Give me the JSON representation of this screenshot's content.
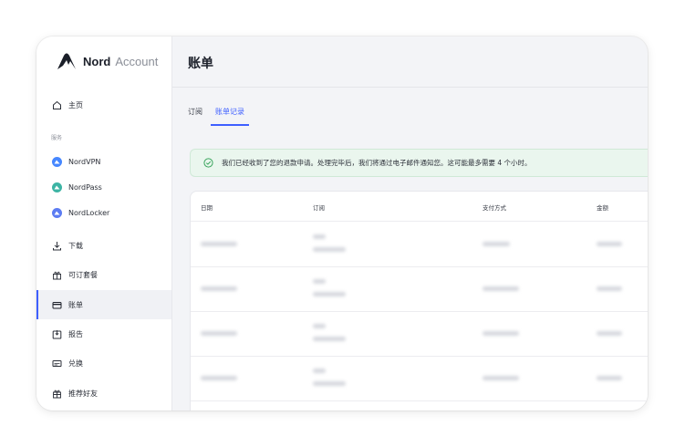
{
  "brand": {
    "name": "Nord",
    "product": "Account"
  },
  "sidebar": {
    "home": {
      "label": "主页",
      "icon": "home-icon"
    },
    "section_heading": "服务",
    "services": [
      {
        "label": "NordVPN",
        "color": "#4687ff"
      },
      {
        "label": "NordPass",
        "color": "#3db4a4"
      },
      {
        "label": "NordLocker",
        "color": "#5c7cf2"
      }
    ],
    "items": [
      {
        "label": "下载",
        "icon": "download-icon"
      },
      {
        "label": "可订套餐",
        "icon": "plans-icon"
      },
      {
        "label": "账单",
        "icon": "billing-card-icon",
        "active": true
      },
      {
        "label": "报告",
        "icon": "report-icon"
      },
      {
        "label": "兑换",
        "icon": "redeem-icon"
      },
      {
        "label": "推荐好友",
        "icon": "gift-icon"
      }
    ]
  },
  "page": {
    "title": "账单"
  },
  "tabs": [
    {
      "label": "订阅",
      "active": false
    },
    {
      "label": "账单记录",
      "active": true
    }
  ],
  "alert": {
    "icon": "check-circle-icon",
    "text": "我们已经收到了您的退款申请。处理完毕后，我们将通过电子邮件通知您。这可能最多需要 4 个小时。"
  },
  "table": {
    "columns": [
      "日期",
      "订阅",
      "支付方式",
      "金额"
    ],
    "row_count_visible": 4
  },
  "colors": {
    "accent": "#3e5fff",
    "success_bg": "#eaf6ee",
    "success_icon": "#3aa55d"
  }
}
